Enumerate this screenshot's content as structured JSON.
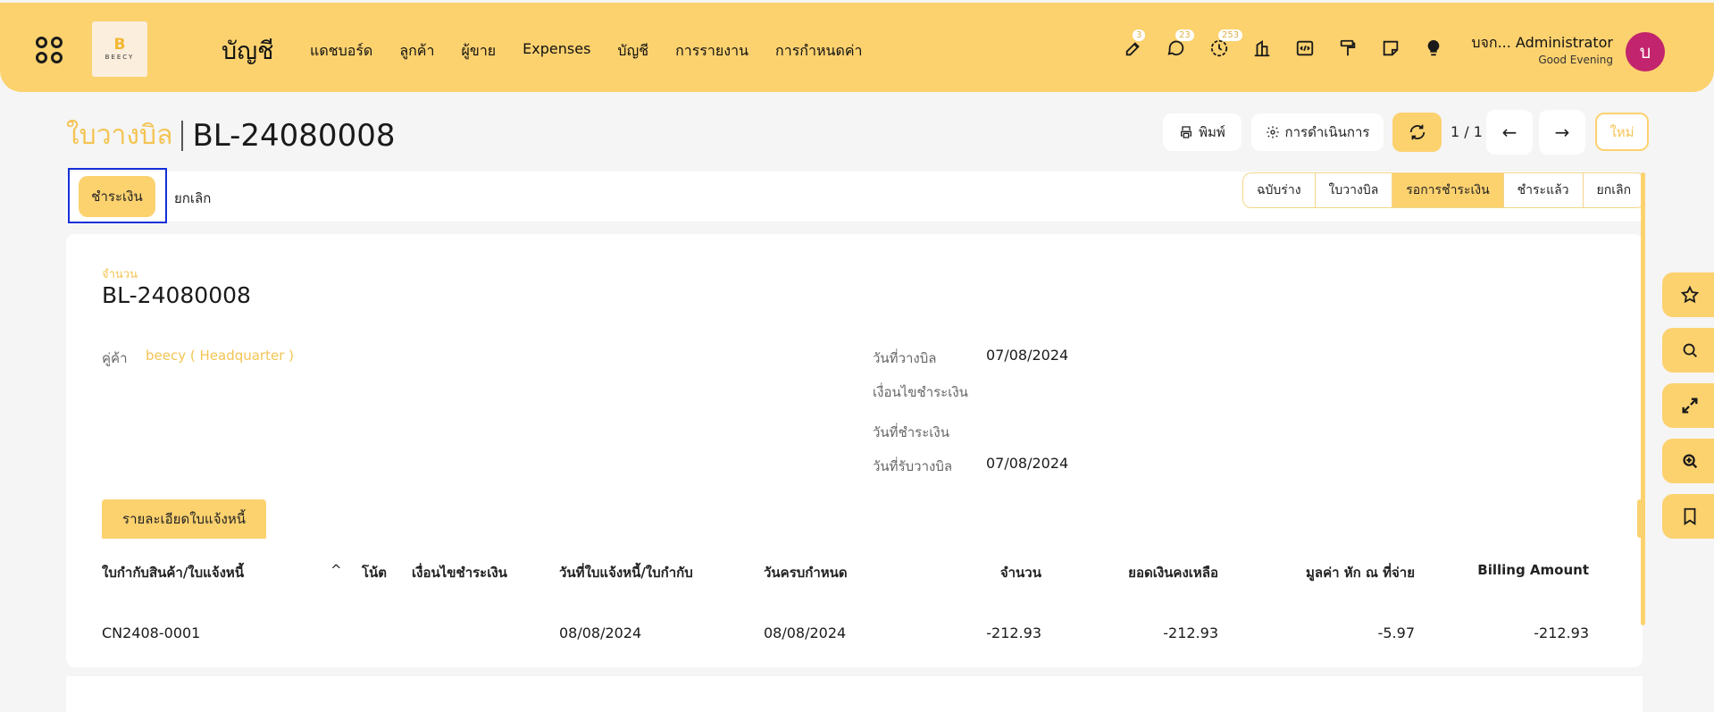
{
  "topbar": {
    "logo_letter": "B",
    "logo_text": "BEECY",
    "app_title": "บัญชี",
    "nav": [
      "แดชบอร์ด",
      "ลูกค้า",
      "ผู้ขาย",
      "Expenses",
      "บัญชี",
      "การรายงาน",
      "การกำหนดค่า"
    ],
    "badges": {
      "edit": "3",
      "chat": "23",
      "activity": "253"
    },
    "user_name": "บจก... Administrator",
    "greeting": "Good Evening",
    "avatar_initial": "บ",
    "accent_color": "#fcd26f",
    "avatar_color": "#c2246d"
  },
  "control": {
    "breadcrumb_parent": "ใบวางบิล",
    "breadcrumb_current": "BL-24080008",
    "print_label": "พิมพ์",
    "action_label": "การดำเนินการ",
    "pager": "1 / 1",
    "new_label": "ใหม่"
  },
  "statusbar": {
    "pay_label": "ชำระเงิน",
    "cancel_label": "ยกเลิก",
    "stages": [
      "ฉบับร่าง",
      "ใบวางบิล",
      "รอการชำระเงิน",
      "ชำระแล้ว",
      "ยกเลิก"
    ],
    "active_stage": "รอการชำระเงิน"
  },
  "form": {
    "name_label": "จำนวน",
    "name": "BL-24080008",
    "partner_label": "คู่ค้า",
    "partner_value": "beecy ( Headquarter )",
    "billing_date_label": "วันที่วางบิล",
    "billing_date": "07/08/2024",
    "payment_term_label": "เงื่อนไขชำระเงิน",
    "payment_date_label": "วันที่ชำระเงิน",
    "receive_date_label": "วันที่รับวางบิล",
    "receive_date": "07/08/2024",
    "tab_label": "รายละเอียดใบแจ้งหนี้"
  },
  "table": {
    "columns": [
      "ใบกำกับสินค้า/ใบแจ้งหนี้",
      "โน้ต",
      "เงื่อนไขชำระเงิน",
      "วันที่ใบแจ้งหนี้/ใบกำกับ",
      "วันครบกำหนด",
      "จำนวน",
      "ยอดเงินคงเหลือ",
      "มูลค่า หัก ณ ที่จ่าย",
      "Billing Amount"
    ],
    "rows": [
      {
        "invoice": "CN2408-0001",
        "note": "",
        "term": "",
        "invoice_date": "08/08/2024",
        "due_date": "08/08/2024",
        "amount": "-212.93",
        "residual": "-212.93",
        "wht": "-5.97",
        "billing_amount": "-212.93"
      }
    ]
  }
}
